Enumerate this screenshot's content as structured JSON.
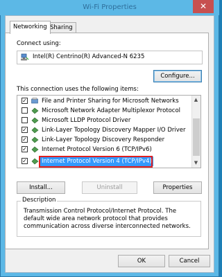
{
  "window": {
    "title": "Wi-Fi Properties",
    "close_glyph": "✕"
  },
  "tabs": [
    {
      "label": "Networking",
      "active": true
    },
    {
      "label": "Sharing",
      "active": false
    }
  ],
  "connect_using": {
    "label": "Connect using:",
    "adapter": "Intel(R) Centrino(R) Advanced-N 6235",
    "configure_button": "Configure..."
  },
  "components": {
    "label": "This connection uses the following items:",
    "items": [
      {
        "label": "File and Printer Sharing for Microsoft Networks",
        "checked": true,
        "icon": "service-icon"
      },
      {
        "label": "Microsoft Network Adapter Multiplexor Protocol",
        "checked": false,
        "icon": "protocol-icon"
      },
      {
        "label": "Microsoft LLDP Protocol Driver",
        "checked": false,
        "icon": "protocol-icon"
      },
      {
        "label": "Link-Layer Topology Discovery Mapper I/O Driver",
        "checked": true,
        "icon": "protocol-icon"
      },
      {
        "label": "Link-Layer Topology Discovery Responder",
        "checked": true,
        "icon": "protocol-icon"
      },
      {
        "label": "Internet Protocol Version 6 (TCP/IPv6)",
        "checked": true,
        "icon": "protocol-icon"
      },
      {
        "label": "Internet Protocol Version 4 (TCP/IPv4)",
        "checked": true,
        "icon": "protocol-icon",
        "selected": true
      }
    ]
  },
  "item_buttons": {
    "install": "Install...",
    "uninstall": "Uninstall",
    "properties": "Properties"
  },
  "description": {
    "legend": "Description",
    "text": "Transmission Control Protocol/Internet Protocol. The default wide area network protocol that provides communication across diverse interconnected networks."
  },
  "dialog_buttons": {
    "ok": "OK",
    "cancel": "Cancel"
  },
  "colors": {
    "title_bar": "#5cb8e6",
    "close_button": "#c75050",
    "selection": "#3399ff",
    "highlight_outline": "#e02020"
  }
}
